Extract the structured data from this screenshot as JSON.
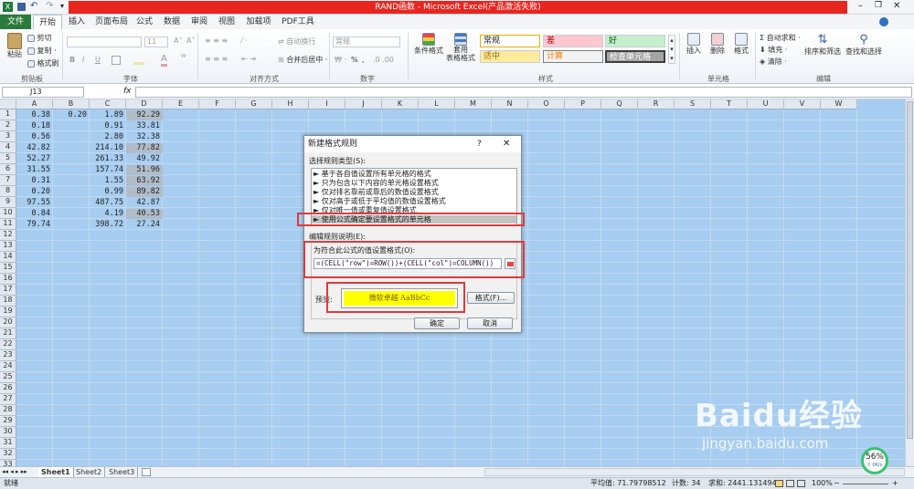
{
  "window": {
    "title": "RAND函数 - Microsoft Excel(产品激活失败)",
    "qat_more": "▾"
  },
  "tabs": [
    {
      "label": "文件"
    },
    {
      "label": "开始"
    },
    {
      "label": "插入"
    },
    {
      "label": "页面布局"
    },
    {
      "label": "公式"
    },
    {
      "label": "数据"
    },
    {
      "label": "审阅"
    },
    {
      "label": "视图"
    },
    {
      "label": "加载项"
    },
    {
      "label": "PDF工具"
    }
  ],
  "ribbon": {
    "clipboard": {
      "paste": "粘贴",
      "cut": "剪切",
      "copy": "复制 ·",
      "format_painter": "格式刷",
      "group": "剪贴板"
    },
    "font": {
      "size": "11",
      "group": "字体",
      "bold": "B",
      "italic": "I",
      "underline": "U",
      "grow": "A˄",
      "shrink": "A˅"
    },
    "alignment": {
      "wrap": "自动换行",
      "merge": "合并后居中 ·",
      "group": "对齐方式"
    },
    "number": {
      "format": "常规",
      "group": "数字",
      "percent": "%",
      "comma": ","
    },
    "styles": {
      "conditional": "条件格式",
      "table": "套用\n表格格式",
      "cells": [
        "常规",
        "差",
        "好",
        "适中",
        "计算",
        "检查单元格"
      ],
      "group": "样式"
    },
    "cells": {
      "insert": "插入",
      "delete": "删除",
      "format": "格式",
      "group": "单元格"
    },
    "editing": {
      "autosum": "Σ 自动求和 ·",
      "fill": "填充 ·",
      "clear": "清除 ·",
      "sort": "排序和筛选",
      "find": "查找和选择",
      "group": "编辑"
    },
    "colors": {
      "bad": "#ffc7ce",
      "good": "#c6efce",
      "neutral": "#ffeb9c",
      "calc": "#f2f2f2",
      "check": "#a5a5a5"
    }
  },
  "formula_bar": {
    "name_box": "J13",
    "fx": "fx",
    "value": ""
  },
  "columns": [
    "A",
    "B",
    "C",
    "D",
    "E",
    "F",
    "G",
    "H",
    "I",
    "J",
    "K",
    "L",
    "M",
    "N",
    "O",
    "P",
    "Q",
    "R",
    "S",
    "T",
    "U",
    "V",
    "W"
  ],
  "rows": [
    "1",
    "2",
    "3",
    "4",
    "5",
    "6",
    "7",
    "8",
    "9",
    "10",
    "11",
    "12",
    "13",
    "14",
    "15",
    "16",
    "17",
    "18",
    "19",
    "20",
    "21",
    "22",
    "23",
    "24",
    "25",
    "26",
    "27",
    "28",
    "29",
    "30",
    "31",
    "32",
    "33"
  ],
  "cells": {
    "A": [
      "0.38",
      "0.18",
      "0.56",
      "42.82",
      "52.27",
      "31.55",
      "0.31",
      "0.20",
      "97.55",
      "0.84",
      "79.74"
    ],
    "B": [
      "0.20",
      "",
      "",
      "",
      "",
      "",
      "",
      "",
      "",
      "",
      ""
    ],
    "C": [
      "1.89",
      "0.91",
      "2.80",
      "214.10",
      "261.33",
      "157.74",
      "1.55",
      "0.99",
      "487.75",
      "4.19",
      "398.72"
    ],
    "D": [
      "92.29",
      "33.81",
      "32.38",
      "77.82",
      "49.92",
      "51.96",
      "63.92",
      "89.82",
      "42.87",
      "40.53",
      "27.24"
    ],
    "D_highlight": [
      true,
      false,
      false,
      true,
      false,
      true,
      true,
      true,
      false,
      true,
      false
    ]
  },
  "dialog": {
    "title": "新建格式规则",
    "help": "?",
    "close": "✕",
    "rule_type_label": "选择规则类型(S):",
    "rule_types": [
      "► 基于各自值设置所有单元格的格式",
      "► 只为包含以下内容的单元格设置格式",
      "► 仅对排名靠前或靠后的数值设置格式",
      "► 仅对高于或低于平均值的数值设置格式",
      "► 仅对唯一值或重复值设置格式",
      "► 使用公式确定要设置格式的单元格"
    ],
    "selected_index": 5,
    "edit_label": "编辑规则说明(E):",
    "formula_label": "为符合此公式的值设置格式(O):",
    "formula": "=(CELL(\"row\")=ROW())+(CELL(\"col\")=COLUMN())",
    "preview_label": "预览:",
    "preview_text": "微软卓越  AaBbCc",
    "preview_color": "#ffff00",
    "format_button": "格式(F)...",
    "ok": "确定",
    "cancel": "取消"
  },
  "sheets": [
    "Sheet1",
    "Sheet2",
    "Sheet3"
  ],
  "status": {
    "ready": "就绪",
    "average": "平均值: 71.79798512",
    "count": "计数: 34",
    "sum": "求和: 2441.131494",
    "zoom": "100%",
    "zoom_minus": "−",
    "zoom_plus": "+"
  },
  "overlay": {
    "speed_percent": "56%",
    "speed_rate": "↑ 0K/s",
    "watermark_main": "Baidu经验",
    "watermark_sub": "jingyan.baidu.com"
  }
}
